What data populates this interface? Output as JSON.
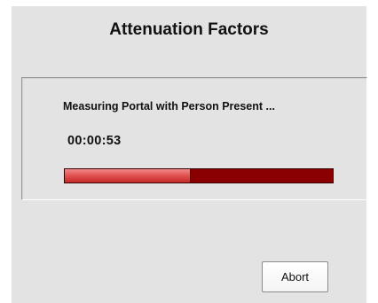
{
  "dialog": {
    "title": "Attenuation Factors"
  },
  "measurement": {
    "status_text": "Measuring Portal with Person Present ...",
    "elapsed_time": "00:00:53",
    "progress_fraction": 0.47,
    "colors": {
      "progress_fill": "#e25555",
      "progress_track": "#8a0000"
    }
  },
  "buttons": {
    "abort_label": "Abort"
  }
}
